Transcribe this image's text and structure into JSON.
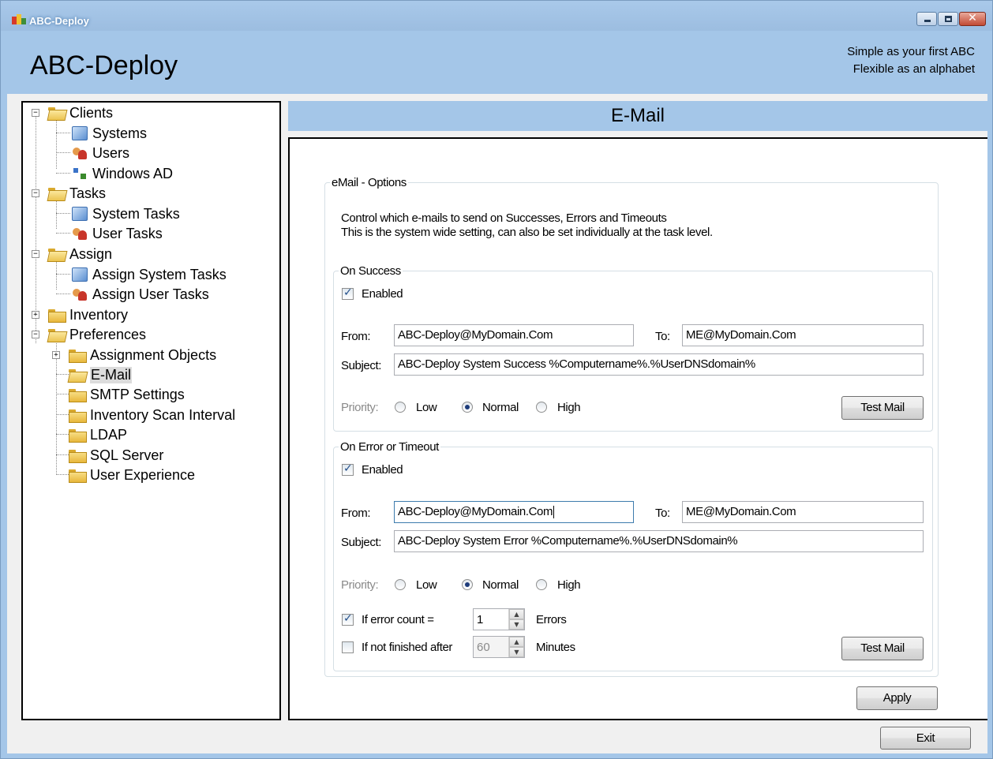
{
  "window": {
    "title": "ABC-Deploy",
    "app_title": "ABC-Deploy",
    "slogan_line1": "Simple as your first ABC",
    "slogan_line2": "Flexible as an alphabet"
  },
  "tree": {
    "clients": "Clients",
    "systems": "Systems",
    "users": "Users",
    "windows_ad": "Windows AD",
    "tasks": "Tasks",
    "system_tasks": "System Tasks",
    "user_tasks": "User Tasks",
    "assign": "Assign",
    "assign_system_tasks": "Assign System Tasks",
    "assign_user_tasks": "Assign User Tasks",
    "inventory": "Inventory",
    "preferences": "Preferences",
    "assignment_objects": "Assignment Objects",
    "email": "E-Mail",
    "smtp_settings": "SMTP Settings",
    "inventory_scan_interval": "Inventory Scan Interval",
    "ldap": "LDAP",
    "sql_server": "SQL Server",
    "user_experience": "User Experience",
    "selected": "E-Mail"
  },
  "pane": {
    "title": "E-Mail",
    "options_legend": "eMail - Options",
    "description_line1": "Control which e-mails to send on Successes, Errors and Timeouts",
    "description_line2": "This is the system wide setting, can also be set individually at the task level."
  },
  "success": {
    "legend": "On  Success",
    "enabled_label": "Enabled",
    "enabled": true,
    "from_label": "From:",
    "from_value": "ABC-Deploy@MyDomain.Com",
    "to_label": "To:",
    "to_value": "ME@MyDomain.Com",
    "subject_label": "Subject:",
    "subject_value": "ABC-Deploy System Success %Computername%.%UserDNSdomain%",
    "priority_label": "Priority:",
    "priority_low": "Low",
    "priority_normal": "Normal",
    "priority_high": "High",
    "priority_selected": "Normal",
    "test_mail": "Test Mail"
  },
  "error": {
    "legend": "On  Error or Timeout",
    "enabled_label": "Enabled",
    "enabled": true,
    "from_label": "From:",
    "from_value": "ABC-Deploy@MyDomain.Com",
    "to_label": "To:",
    "to_value": "ME@MyDomain.Com",
    "subject_label": "Subject:",
    "subject_value": "ABC-Deploy System Error %Computername%.%UserDNSdomain%",
    "priority_label": "Priority:",
    "priority_low": "Low",
    "priority_normal": "Normal",
    "priority_high": "High",
    "priority_selected": "Normal",
    "error_count_label": "If error count =",
    "error_count_checked": true,
    "error_count_value": "1",
    "errors_unit": "Errors",
    "not_finished_label": "If not finished after",
    "not_finished_checked": false,
    "not_finished_value": "60",
    "minutes_unit": "Minutes",
    "test_mail": "Test Mail"
  },
  "actions": {
    "apply": "Apply",
    "exit": "Exit"
  }
}
